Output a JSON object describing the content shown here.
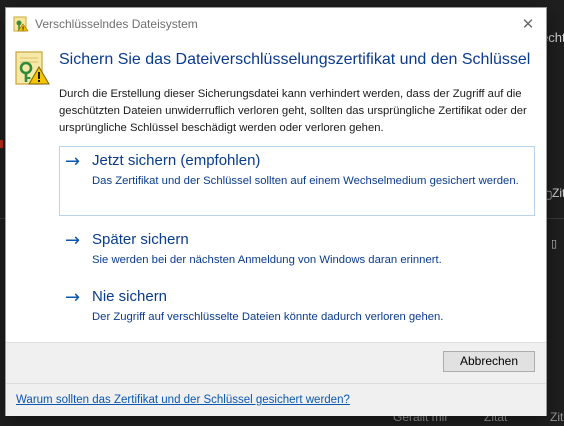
{
  "background": {
    "fragments": [
      "echt",
      "Zit",
      "Zit",
      "Geralit mir",
      "Zitat",
      "Zit"
    ]
  },
  "dialog": {
    "window_title": "Verschlüsselndes Dateisystem",
    "heading": "Sichern Sie das Dateiverschlüsselungszertifikat und den Schlüssel",
    "description": "Durch die Erstellung dieser Sicherungsdatei kann verhindert werden, dass der Zugriff auf die geschützten Dateien unwiderruflich verloren geht, sollten das ursprüngliche Zertifikat oder der ursprüngliche Schlüssel beschädigt werden oder verloren gehen.",
    "options": [
      {
        "title": "Jetzt sichern (empfohlen)",
        "description": "Das Zertifikat und der Schlüssel sollten auf einem Wechselmedium gesichert werden."
      },
      {
        "title": "Später sichern",
        "description": "Sie werden bei der nächsten Anmeldung von Windows daran erinnert."
      },
      {
        "title": "Nie sichern",
        "description": "Der Zugriff auf verschlüsselte Dateien könnte dadurch verloren gehen."
      }
    ],
    "cancel_label": "Abbrechen",
    "help_link": "Warum sollten das Zertifikat und der Schlüssel gesichert werden?",
    "close_glyph": "✕",
    "arrow_glyph": "→"
  },
  "colors": {
    "heading": "#0a3b8c",
    "link": "#0a57b0",
    "footer": "#f0f0f0"
  }
}
